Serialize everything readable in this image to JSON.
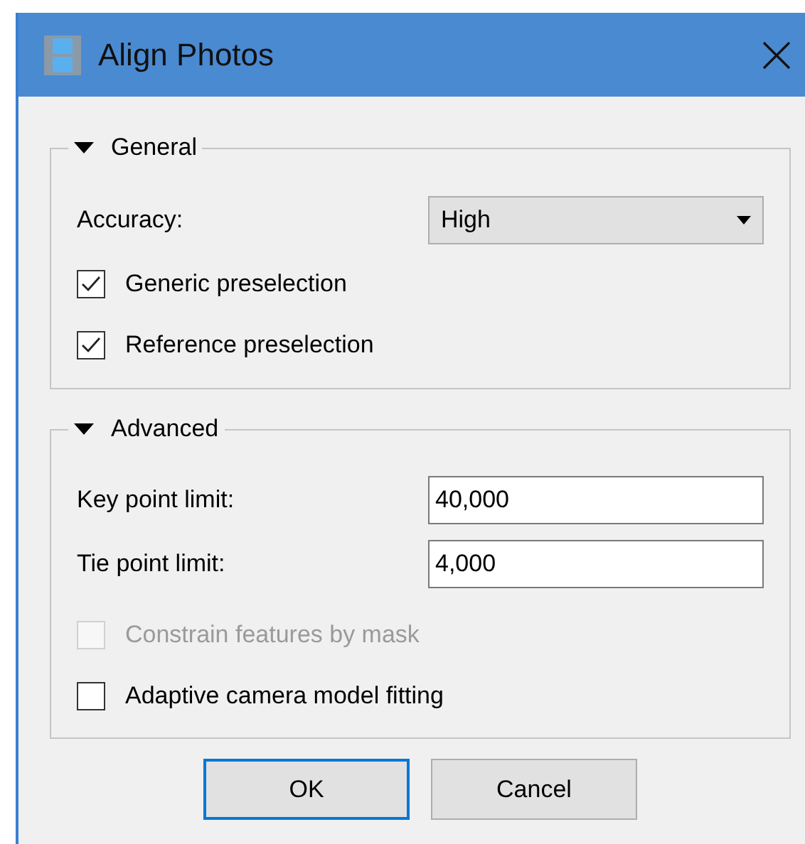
{
  "window": {
    "title": "Align Photos"
  },
  "sections": [
    {
      "title": "General",
      "expanded": true,
      "items": [
        {
          "kind": "combo",
          "label": "Accuracy:",
          "value": "High"
        },
        {
          "kind": "check",
          "label": "Generic preselection",
          "checked": true,
          "disabled": false
        },
        {
          "kind": "check",
          "label": "Reference preselection",
          "checked": true,
          "disabled": false
        }
      ]
    },
    {
      "title": "Advanced",
      "expanded": true,
      "items": [
        {
          "kind": "field",
          "label": "Key point limit:",
          "value": "40,000"
        },
        {
          "kind": "field",
          "label": "Tie point limit:",
          "value": "4,000"
        },
        {
          "kind": "check",
          "label": "Constrain features by mask",
          "checked": false,
          "disabled": true
        },
        {
          "kind": "check",
          "label": "Adaptive camera model fitting",
          "checked": false,
          "disabled": false
        }
      ]
    }
  ],
  "buttons": [
    {
      "label": "OK",
      "default": true
    },
    {
      "label": "Cancel",
      "default": false
    }
  ]
}
